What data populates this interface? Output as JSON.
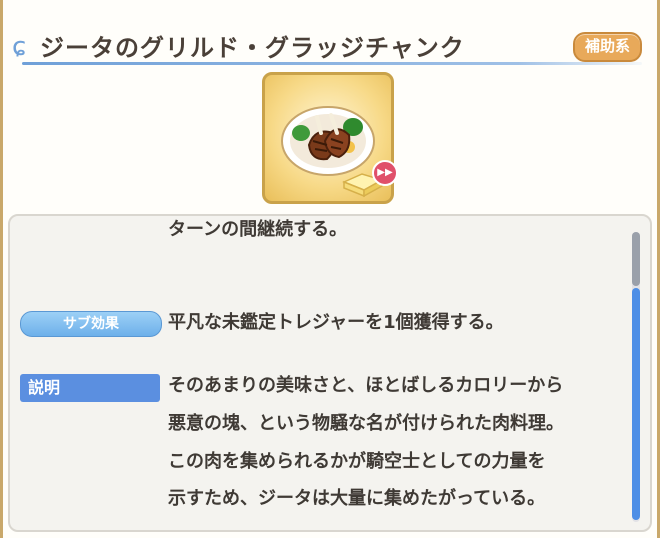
{
  "header": {
    "title": "ジータのグリルド・グラッジチャンク",
    "category_badge": "補助系"
  },
  "item": {
    "icon": "grilled-steak-icon",
    "quick_use_icon": "fast-forward-icon"
  },
  "details": {
    "effect_tail": "ターンの間継続する。",
    "sub_effect_label": "サブ効果",
    "sub_effect_text": "平凡な未鑑定トレジャーを1個獲得する。",
    "description_label": "説明",
    "description_lines": [
      "そのあまりの美味さと、ほとばしるカロリーから",
      "悪意の塊、という物騒な名が付けられた肉料理。",
      "この肉を集められるかが騎空士としての力量を",
      "示すため、ジータは大量に集めたがっている。"
    ]
  },
  "colors": {
    "accent_blue": "#5b8fe0",
    "badge_orange": "#e8a95a",
    "title_text": "#4a4038"
  }
}
